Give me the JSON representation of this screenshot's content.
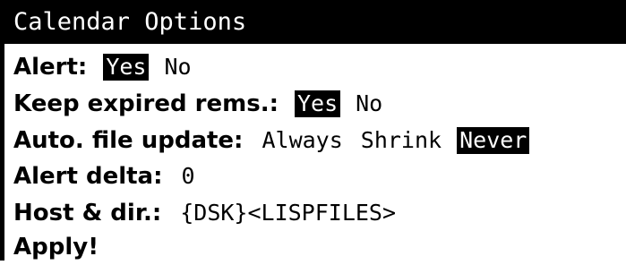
{
  "window": {
    "title": "Calendar Options"
  },
  "options": {
    "alert": {
      "label": "Alert:",
      "choices": [
        "Yes",
        "No"
      ],
      "selected": "Yes"
    },
    "keep_expired": {
      "label": "Keep expired rems.:",
      "choices": [
        "Yes",
        "No"
      ],
      "selected": "Yes"
    },
    "auto_file_update": {
      "label": "Auto. file update:",
      "choices": [
        "Always",
        "Shrink",
        "Never"
      ],
      "selected": "Never"
    },
    "alert_delta": {
      "label": "Alert delta:",
      "value": "0"
    },
    "host_dir": {
      "label": "Host & dir.:",
      "value": "{DSK}<LISPFILES>"
    },
    "apply": {
      "label": "Apply!"
    }
  },
  "colors": {
    "foreground": "#000000",
    "background": "#ffffff",
    "selected_bg": "#000000",
    "selected_fg": "#ffffff"
  }
}
